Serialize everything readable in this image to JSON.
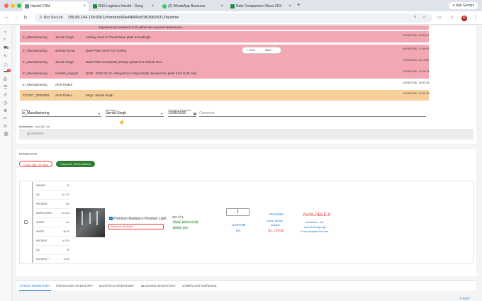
{
  "browser": {
    "tabs": [
      {
        "title": "Harold CRM",
        "active": true
      },
      {
        "title": "B33-Logistics Harold - Goog"
      },
      {
        "title": "(3) WhatsApp Business"
      },
      {
        "title": "Rate Comparison Sheet 3D3"
      }
    ],
    "new_tab": "+",
    "gemini_label": "Ask Gemini",
    "security_label": "Not Secure",
    "url": "159.89.164.134:6061/#/orders/69e4d060ef29630b25312fa/show",
    "avatar_letter": "R"
  },
  "activity_rows": [
    {
      "status": "",
      "user": "",
      "message": "adjusted hole positions to fit within the required dimensions.",
      "time": "",
      "bg": "#f2a7b3"
    },
    {
      "status": "In_Manufacturing",
      "user": "Jarnail Singh",
      "message": "Akshay need to Check Base plate accordingly",
      "time": "09/06/2026, 13:00:11",
      "bg": "#f2a7b3"
    },
    {
      "status": "In_Manufacturing",
      "user": "akshay kumar",
      "message": "Base Plate Send For Cutting",
      "time": "08/06/2026, 12:59:00",
      "bg": "#f2a7b3"
    },
    {
      "status": "In_Manufacturing",
      "user": "Jarnail Singh",
      "message": "Base Plate Completely Ready updated to Rishab also.",
      "time": "11/06/2026, 13:13:59",
      "bg": "#f2a7b3"
    },
    {
      "status": "In_Manufacturing",
      "user": "rishabh_support",
      "message": "DOD : 2026-05-13, delayed by 5 days,Kindly dispatch the plate from B-33 only",
      "time": "12/06/2026, 13:26:18",
      "bg": "#f2a7b3"
    },
    {
      "status": "In_Manufacturing",
      "user": "Amit Thakur",
      "message": "",
      "time": "12/06/2026, 18:52:56",
      "bg": "#ffffff"
    },
    {
      "status": "TICKET_OPENED",
      "user": "Amit Thakur",
      "message": "Mngr: Jarnail Singh",
      "time": "12/06/2026, 18:52:56",
      "bg": "#f6cf9a"
    }
  ],
  "pager": {
    "prev": "Prev",
    "next": "Next"
  },
  "form": {
    "status_label": "Status",
    "status_value": "In_Manufacturing",
    "manager_label": "Manager",
    "manager_value": "Jarnail Singh",
    "dispatch_label": "Tentative Dispatch",
    "dispatch_value": "13/05/2026",
    "comment_placeholder": "Comment",
    "installation": "Installation - no | QC: no",
    "update_label": "UPDATE"
  },
  "products": {
    "section_label": "PRODUCTS",
    "order_age": "Order Age: 26 days",
    "payment": "Payment: 100% cleared",
    "side_list": [
      {
        "label": "WIRING",
        "value": "7h"
      },
      {
        "label": "QC",
        "value": "1d 17h"
      },
      {
        "label": "PACKING",
        "value": "9m"
      },
      {
        "label": "DISPATCHED",
        "value": "8d 20h"
      },
      {
        "label": "SHEET",
        "value": "9m"
      },
      {
        "label": "SHEET",
        "value": "4d 3h"
      },
      {
        "label": "PACKING",
        "value": "1d 37h"
      },
      {
        "label": "QC",
        "value": "2h"
      },
      {
        "label": "PACKING *",
        "value": "7d 4h"
      }
    ],
    "item": {
      "name": "Premium Radiance Pendant Light",
      "note": "Same as Website.",
      "set": "Set of 3",
      "plate": "Plate: Mirror Gold",
      "bulbs": "Bulbs: yes",
      "quantity": "1",
      "custom": "CUSTOM",
      "qc": "QC",
      "packing_status": "PACKING",
      "packer": "kumar_akshay",
      "packer_loc": "aluvallin",
      "qc_issue": "QC_ISSUE",
      "availability": "AVAILABLE.0",
      "avail_user": "teamcumar - iad",
      "avail_age": "around 88 days ago",
      "lead_time": "5 days dispatch lead time"
    }
  },
  "bottom_tabs": [
    "STOCK INVENTORY",
    "PURCHASE INVENTORY",
    "DISPATCH INVENTORY",
    "BLOCKED INVENTORY",
    "COMPLAINT EXPENSE"
  ],
  "edit_label": "EDIT",
  "colors": {
    "accent": "#1976d2",
    "green": "#2e7d32",
    "red": "#e53935",
    "pink_row": "#f2a7b3",
    "orange_row": "#f6cf9a"
  }
}
